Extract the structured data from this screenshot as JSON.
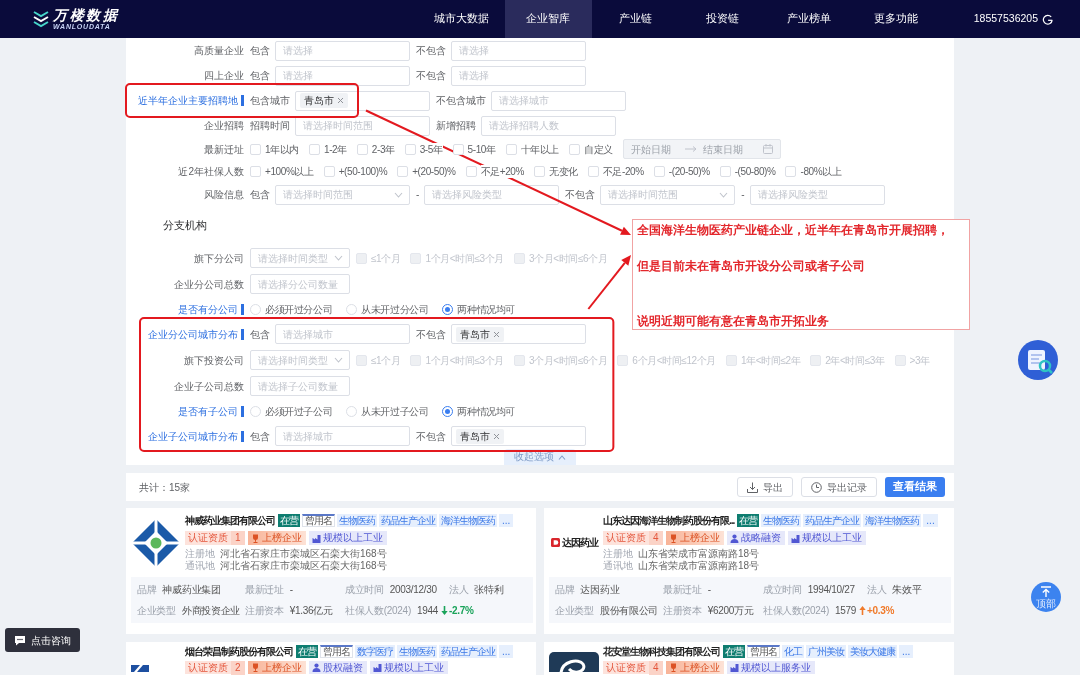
{
  "nav": {
    "brand": "万楼数据",
    "brand_sub": "WANLOUDATA",
    "items": [
      {
        "label": "城市大数据",
        "selected": false
      },
      {
        "label": "企业智库",
        "selected": true
      },
      {
        "label": "产业链",
        "selected": false
      },
      {
        "label": "投资链",
        "selected": false
      },
      {
        "label": "产业榜单",
        "selected": false
      },
      {
        "label": "更多功能",
        "selected": false
      }
    ],
    "phone": "18557536205"
  },
  "filters": [
    {
      "label": "高质量企业",
      "active": false,
      "label_framed": false,
      "parts": [
        {
          "kind": "text",
          "text": "包含"
        },
        {
          "kind": "input",
          "placeholder": "请选择"
        },
        {
          "kind": "text",
          "text": "不包含"
        },
        {
          "kind": "input",
          "placeholder": "请选择"
        }
      ]
    },
    {
      "label": "四上企业",
      "active": false,
      "label_framed": false,
      "parts": [
        {
          "kind": "text",
          "text": "包含"
        },
        {
          "kind": "input",
          "placeholder": "请选择"
        },
        {
          "kind": "text",
          "text": "不包含"
        },
        {
          "kind": "input",
          "placeholder": "请选择"
        }
      ]
    },
    {
      "label": "近半年企业主要招聘地",
      "active": true,
      "label_framed": true,
      "parts": [
        {
          "kind": "text",
          "text": "包含城市"
        },
        {
          "kind": "tags",
          "tags": [
            "青岛市"
          ]
        },
        {
          "kind": "text",
          "text": "不包含城市"
        },
        {
          "kind": "input",
          "placeholder": "请选择城市"
        }
      ]
    },
    {
      "label": "企业招聘",
      "active": false,
      "label_framed": false,
      "parts": [
        {
          "kind": "text",
          "text": "招聘时间"
        },
        {
          "kind": "input",
          "placeholder": "请选择时间范围"
        },
        {
          "kind": "text",
          "text": "新增招聘"
        },
        {
          "kind": "input",
          "placeholder": "请选择招聘人数"
        }
      ]
    },
    {
      "label": "最新迁址",
      "active": false,
      "label_framed": false,
      "parts": [
        {
          "kind": "checkbox",
          "label": "1年以内",
          "checked": false,
          "disabled": false
        },
        {
          "kind": "checkbox",
          "label": "1-2年",
          "checked": false,
          "disabled": false
        },
        {
          "kind": "checkbox",
          "label": "2-3年",
          "checked": false,
          "disabled": false
        },
        {
          "kind": "checkbox",
          "label": "3-5年",
          "checked": false,
          "disabled": false
        },
        {
          "kind": "checkbox",
          "label": "5-10年",
          "checked": false,
          "disabled": false
        },
        {
          "kind": "checkbox",
          "label": "十年以上",
          "checked": false,
          "disabled": false
        },
        {
          "kind": "checkbox",
          "label": "自定义",
          "checked": false,
          "disabled": false
        },
        {
          "kind": "date_range",
          "start": {
            "placeholder": "开始日期"
          },
          "end": {
            "placeholder": "结束日期"
          },
          "disabled": true
        }
      ]
    },
    {
      "label": "近2年社保人数",
      "active": false,
      "label_framed": false,
      "parts": [
        {
          "kind": "checkbox",
          "label": "+100%以上",
          "checked": false,
          "disabled": false
        },
        {
          "kind": "checkbox",
          "label": "+(50-100)%",
          "checked": false,
          "disabled": false
        },
        {
          "kind": "checkbox",
          "label": "+(20-50)%",
          "checked": false,
          "disabled": false
        },
        {
          "kind": "checkbox",
          "label": "不足+20%",
          "checked": false,
          "disabled": false
        },
        {
          "kind": "checkbox",
          "label": "无变化",
          "checked": false,
          "disabled": false
        },
        {
          "kind": "checkbox",
          "label": "不足-20%",
          "checked": false,
          "disabled": false
        },
        {
          "kind": "checkbox",
          "label": "-(20-50)%",
          "checked": false,
          "disabled": false
        },
        {
          "kind": "checkbox",
          "label": "-(50-80)%",
          "checked": false,
          "disabled": false
        },
        {
          "kind": "checkbox",
          "label": "-80%以上",
          "checked": false,
          "disabled": false
        }
      ]
    },
    {
      "label": "风险信息",
      "active": false,
      "label_framed": false,
      "parts": [
        {
          "kind": "text",
          "text": "包含"
        },
        {
          "kind": "select",
          "placeholder": "请选择时间范围"
        },
        {
          "kind": "text",
          "text": "-"
        },
        {
          "kind": "input",
          "placeholder": "请选择风险类型"
        },
        {
          "kind": "text",
          "text": "不包含"
        },
        {
          "kind": "select",
          "placeholder": "请选择时间范围"
        },
        {
          "kind": "text",
          "text": "-"
        },
        {
          "kind": "input",
          "placeholder": "请选择风险类型"
        }
      ]
    }
  ],
  "branch": {
    "title": "分支机构",
    "rows": [
      {
        "label": "旗下分公司",
        "active": false,
        "parts": [
          {
            "kind": "select",
            "placeholder": "请选择时间类型"
          },
          {
            "kind": "checkbox",
            "label": "≤1个月",
            "checked": false,
            "disabled": true
          },
          {
            "kind": "checkbox",
            "label": "1个月<时间≤3个月",
            "checked": false,
            "disabled": true
          },
          {
            "kind": "checkbox",
            "label": "3个月<时间≤6个月",
            "checked": false,
            "disabled": true
          }
        ]
      },
      {
        "label": "企业分公司总数",
        "active": false,
        "parts": [
          {
            "kind": "input",
            "placeholder": "请选择分公司数量"
          }
        ]
      },
      {
        "label": "是否有分公司",
        "active": true,
        "parts": [
          {
            "kind": "radio",
            "label": "必须开过分公司",
            "selected": false
          },
          {
            "kind": "radio",
            "label": "从未开过分公司",
            "selected": false
          },
          {
            "kind": "radio",
            "label": "两种情况均可",
            "selected": true
          }
        ]
      }
    ],
    "framed_rows": [
      {
        "label": "企业分公司城市分布",
        "active": true,
        "parts": [
          {
            "kind": "text",
            "text": "包含"
          },
          {
            "kind": "input",
            "placeholder": "请选择城市"
          },
          {
            "kind": "text",
            "text": "不包含"
          },
          {
            "kind": "tags",
            "tags": [
              "青岛市"
            ]
          }
        ]
      },
      {
        "label": "旗下投资公司",
        "active": false,
        "parts": [
          {
            "kind": "select",
            "placeholder": "请选择时间类型"
          },
          {
            "kind": "checkbox",
            "label": "≤1个月",
            "checked": false,
            "disabled": true
          },
          {
            "kind": "checkbox",
            "label": "1个月<时间≤3个月",
            "checked": false,
            "disabled": true
          },
          {
            "kind": "checkbox",
            "label": "3个月<时间≤6个月",
            "checked": false,
            "disabled": true
          },
          {
            "kind": "checkbox",
            "label": "6个月<时间≤12个月",
            "checked": false,
            "disabled": true
          },
          {
            "kind": "checkbox",
            "label": "1年<时间≤2年",
            "checked": false,
            "disabled": true
          },
          {
            "kind": "checkbox",
            "label": "2年<时间≤3年",
            "checked": false,
            "disabled": true
          },
          {
            "kind": "checkbox",
            "label": ">3年",
            "checked": false,
            "disabled": true
          }
        ]
      },
      {
        "label": "企业子公司总数",
        "active": false,
        "parts": [
          {
            "kind": "input",
            "placeholder": "请选择子公司数量"
          }
        ]
      },
      {
        "label": "是否有子公司",
        "active": true,
        "parts": [
          {
            "kind": "radio",
            "label": "必须开过子公司",
            "selected": false
          },
          {
            "kind": "radio",
            "label": "从未开过子公司",
            "selected": false
          },
          {
            "kind": "radio",
            "label": "两种情况均可",
            "selected": true
          }
        ]
      },
      {
        "label": "企业子公司城市分布",
        "active": true,
        "parts": [
          {
            "kind": "text",
            "text": "包含"
          },
          {
            "kind": "input",
            "placeholder": "请选择城市"
          },
          {
            "kind": "text",
            "text": "不包含"
          },
          {
            "kind": "tags",
            "tags": [
              "青岛市"
            ]
          }
        ]
      }
    ],
    "fold_button": "收起选项"
  },
  "results": {
    "total": "共计：15家",
    "buttons": [
      {
        "kind": "export",
        "label": "导出"
      },
      {
        "kind": "history",
        "label": "导出记录"
      },
      {
        "kind": "primary",
        "label": "查看结果"
      }
    ]
  },
  "companies": [
    {
      "logo": {
        "kind": "emblem"
      },
      "name": "神威药业集团有限公司",
      "status": "在营",
      "former_name": "曾用名",
      "tags": [
        "生物医药",
        "药品生产企业",
        "海洋生物医药"
      ],
      "more": "...",
      "badges": [
        {
          "kind": "certification",
          "label": "认证资质",
          "count": "1"
        },
        {
          "kind": "ranking",
          "label": "上榜企业"
        },
        {
          "kind": "scale",
          "label": "规模以上工业"
        }
      ],
      "addresses": [
        {
          "label": "注册地",
          "value": "河北省石家庄市栾城区石栾大街168号"
        },
        {
          "label": "通讯地",
          "value": "河北省石家庄市栾城区石栾大街168号"
        }
      ],
      "fact_rows": [
        [
          {
            "label": "品牌",
            "value": "神威药业集团"
          },
          {
            "label": "最新迁址",
            "value": "-"
          },
          {
            "label": "成立时间",
            "value": "2003/12/30"
          },
          {
            "label": "法人",
            "value": "张特利"
          }
        ],
        [
          {
            "label": "企业类型",
            "value": "外商投资企业"
          },
          {
            "label": "注册资本",
            "value": "¥1.36亿元"
          },
          {
            "label": "社保人数(2024)",
            "value": "1944",
            "change": {
              "kind": "down",
              "text": "-2.7%"
            }
          }
        ]
      ]
    },
    {
      "logo": {
        "kind": "wordmark",
        "text": "达因药业"
      },
      "name": "山东达因海洋生物制药股份有限...",
      "status": "在营",
      "tags": [
        "生物医药",
        "药品生产企业",
        "海洋生物医药"
      ],
      "more": "...",
      "badges": [
        {
          "kind": "certification",
          "label": "认证资质",
          "count": "4"
        },
        {
          "kind": "ranking",
          "label": "上榜企业"
        },
        {
          "kind": "funding",
          "label": "战略融资"
        },
        {
          "kind": "scale",
          "label": "规模以上工业"
        }
      ],
      "addresses": [
        {
          "label": "注册地",
          "value": "山东省荣成市富源南路18号"
        },
        {
          "label": "通讯地",
          "value": "山东省荣成市富源南路18号"
        }
      ],
      "fact_rows": [
        [
          {
            "label": "品牌",
            "value": "达因药业"
          },
          {
            "label": "最新迁址",
            "value": "-"
          },
          {
            "label": "成立时间",
            "value": "1994/10/27"
          },
          {
            "label": "法人",
            "value": "朱效平"
          }
        ],
        [
          {
            "label": "企业类型",
            "value": "股份有限公司"
          },
          {
            "label": "注册资本",
            "value": "¥6200万元"
          },
          {
            "label": "社保人数(2024)",
            "value": "1579",
            "change": {
              "kind": "up",
              "text": "+0.3%"
            }
          }
        ]
      ]
    },
    {
      "logo": {
        "kind": "mark"
      },
      "name": "烟台荣昌制药股份有限公司",
      "status": "在营",
      "former_name": "曾用名",
      "tags": [
        "数字医疗",
        "生物医药",
        "药品生产企业"
      ],
      "more": "...",
      "badges": [
        {
          "kind": "certification",
          "label": "认证资质",
          "count": "2"
        },
        {
          "kind": "ranking",
          "label": "上榜企业"
        },
        {
          "kind": "funding",
          "label": "股权融资"
        },
        {
          "kind": "scale",
          "label": "规模以上工业"
        }
      ]
    },
    {
      "logo": {
        "kind": "tile"
      },
      "name": "花安堂生物科技集团有限公司",
      "status": "在营",
      "former_name": "曾用名",
      "tags": [
        "化工",
        "广州美妆",
        "美妆大健康"
      ],
      "more": "...",
      "badges": [
        {
          "kind": "certification",
          "label": "认证资质",
          "count": "4"
        },
        {
          "kind": "ranking",
          "label": "上榜企业"
        },
        {
          "kind": "scale",
          "label": "规模以上服务业"
        }
      ]
    }
  ],
  "annotation": {
    "lines": [
      "全国海洋生物医药产业链企业，近半年在青岛市开展招聘，",
      "但是目前未在青岛市开设分公司或者子公司",
      "说明近期可能有意在青岛市开拓业务"
    ]
  },
  "widgets": {
    "back_to_top": "顶部",
    "consult": "点击咨询"
  }
}
